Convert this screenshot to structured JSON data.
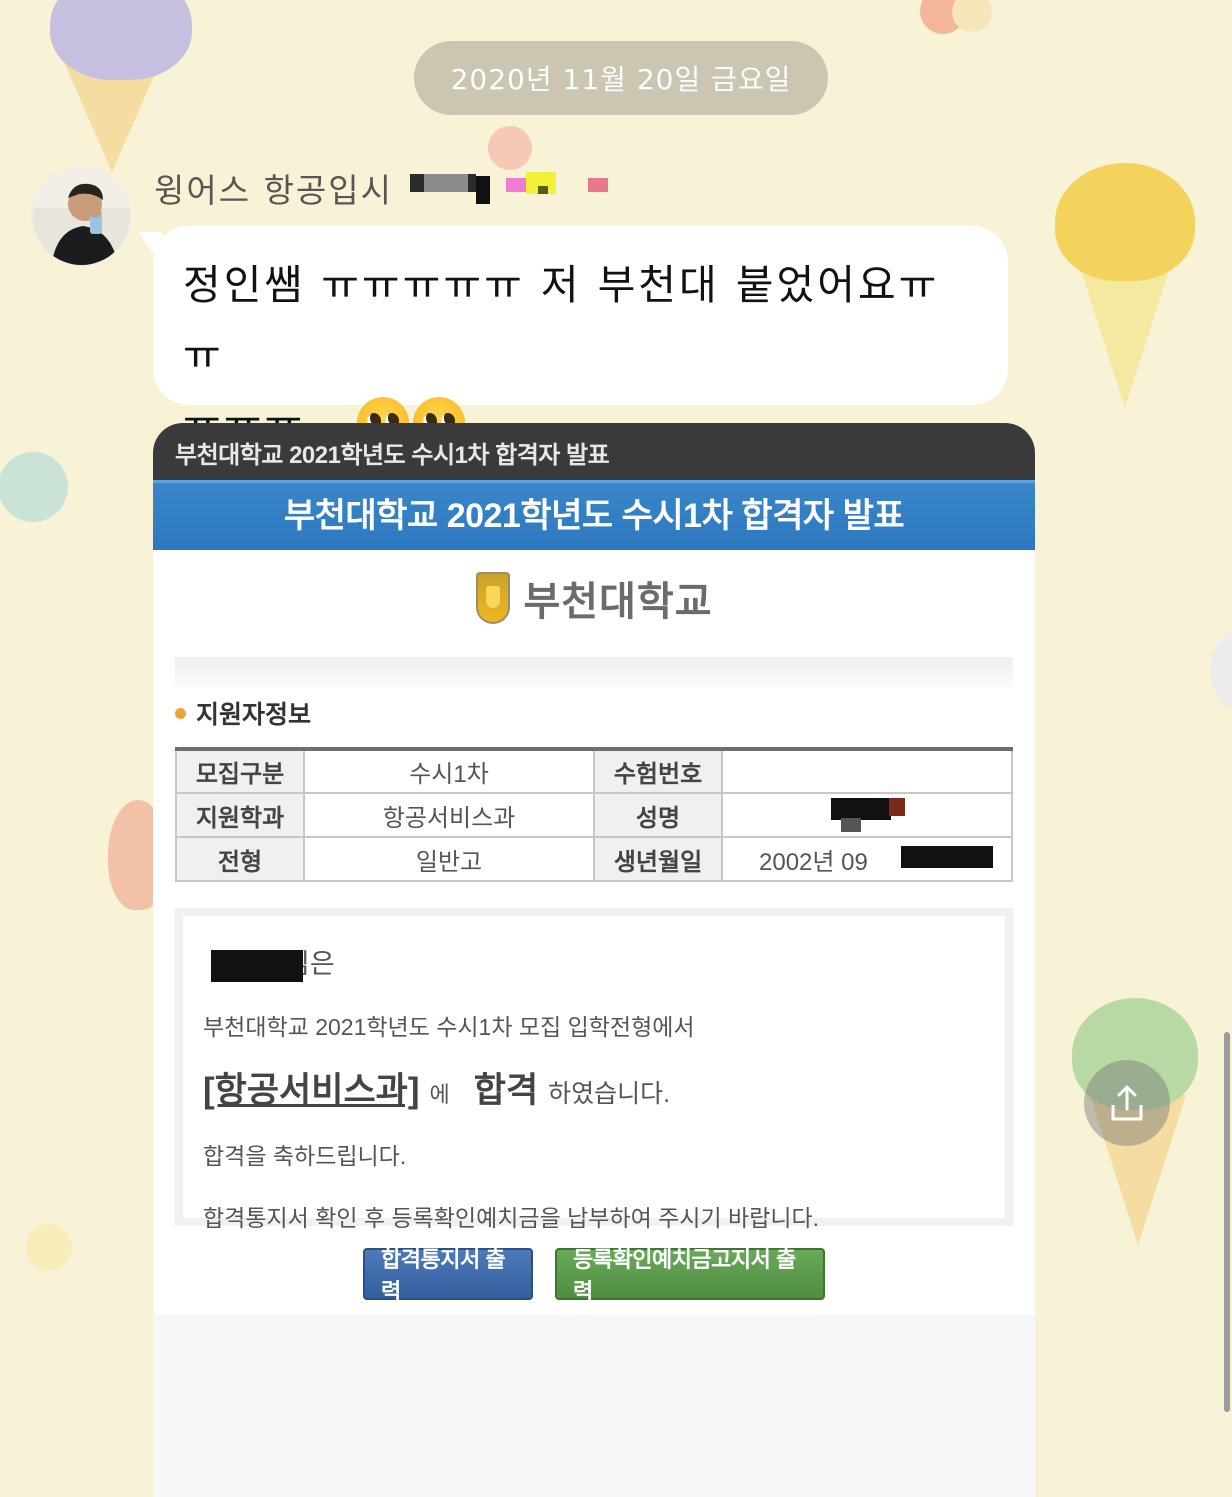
{
  "chat": {
    "date_separator": "2020년 11월 20일 금요일",
    "sender": {
      "name": "윙어스 항공입시",
      "avatar_icon": "profile-photo"
    },
    "message": {
      "line1": "정인쌤 ㅠㅠㅠㅠㅠ 저 부천대 붙었어요ㅠㅠ",
      "line2": "ㅠㅠㅠ...",
      "emoji_count": 2,
      "emoji_name": "pleading-face"
    }
  },
  "attachment": {
    "browser_title": "부천대학교 2021학년도 수시1차 합격자 발표",
    "banner_title": "부천대학교 2021학년도 수시1차 합격자 발표",
    "university_name": "부천대학교",
    "section_title": "지원자정보",
    "table": {
      "rows": [
        {
          "label1": "모집구분",
          "value1": "수시1차",
          "label2": "수험번호",
          "value2": ""
        },
        {
          "label1": "지원학과",
          "value1": "항공서비스과",
          "label2": "성명",
          "value2": ""
        },
        {
          "label1": "전형",
          "value1": "일반고",
          "label2": "생년월일",
          "value2": "2002년 09"
        }
      ]
    },
    "result": {
      "name_suffix": "님은",
      "line1": "부천대학교 2021학년도 수시1차 모집 입학전형에서",
      "dept": "[항공서비스과]",
      "dept_particle": "에",
      "pass_word": "합격",
      "pass_suffix": "하였습니다.",
      "congrats": "합격을 축하드립니다.",
      "instruction": "합격통지서 확인 후 등록확인예치금을 납부하여 주시기 바랍니다."
    },
    "buttons": {
      "print_notice": "합격통지서 출력",
      "print_deposit": "등록확인예치금고지서 출력"
    },
    "colors": {
      "banner": "#2d78bf",
      "btn_blue": "#345f9e",
      "btn_green": "#4f8d3f"
    }
  },
  "ui": {
    "share_icon": "share-icon"
  }
}
